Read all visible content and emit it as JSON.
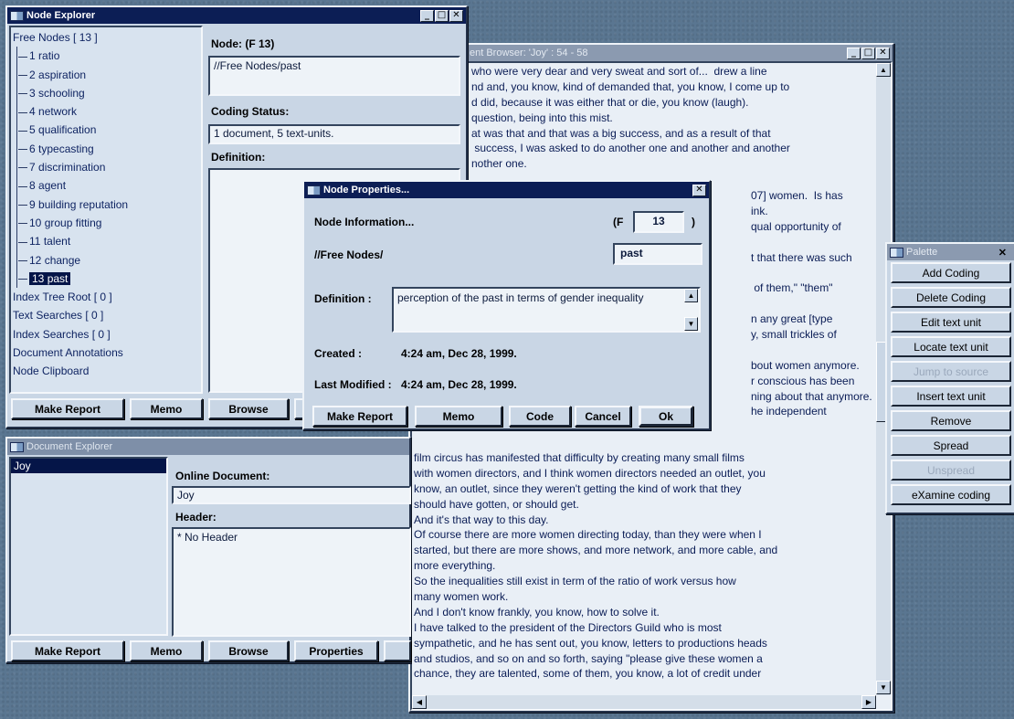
{
  "node_explorer": {
    "title": "Node Explorer",
    "free_nodes_label": "Free Nodes [ 13 ]",
    "nodes": [
      {
        "num": "1",
        "label": "ratio"
      },
      {
        "num": "2",
        "label": "aspiration"
      },
      {
        "num": "3",
        "label": "schooling"
      },
      {
        "num": "4",
        "label": "network"
      },
      {
        "num": "5",
        "label": "qualification"
      },
      {
        "num": "6",
        "label": "typecasting"
      },
      {
        "num": "7",
        "label": "discrimination"
      },
      {
        "num": "8",
        "label": "agent"
      },
      {
        "num": "9",
        "label": "building reputation"
      },
      {
        "num": "10",
        "label": "group fitting"
      },
      {
        "num": "11",
        "label": "talent"
      },
      {
        "num": "12",
        "label": "change"
      },
      {
        "num": "13",
        "label": "past"
      }
    ],
    "roots": [
      "Index Tree Root [ 0 ]",
      "Text Searches [ 0 ]",
      "Index Searches [ 0 ]",
      "Document Annotations",
      "Node Clipboard"
    ],
    "node_label": "Node: (F 13)",
    "node_path": "//Free Nodes/past",
    "coding_status_label": "Coding Status:",
    "coding_status_value": "1 document, 5 text-units.",
    "definition_label": "Definition:",
    "buttons": {
      "make_report": "Make Report",
      "memo": "Memo",
      "browse": "Browse"
    }
  },
  "document_browser": {
    "title": "ent Browser: 'Joy' : 54 - 58",
    "lines_top": [
      "who were very dear and very sweat and sort of...  drew a line",
      "nd and, you know, kind of demanded that, you know, I come up to",
      "d did, because it was either that or die, you know (laugh).",
      "question, being into this mist.",
      "at was that and that was a big success, and as a result of that",
      " success, I was asked to do another one and another and another",
      "nother one."
    ],
    "lines_right": [
      "07] women.  Is has",
      "ink.",
      "qual opportunity of",
      "",
      "t that there was such",
      "",
      " of them,\" \"them\"",
      "",
      "n any great [type",
      "y, small trickles of",
      "",
      "bout women anymore.",
      "r conscious has been",
      "ning about that anymore.",
      "he independent"
    ],
    "lines_bottom": [
      "film circus has manifested that difficulty by creating many small films",
      "with women directors, and I think women directors needed an outlet, you",
      "know, an outlet, since they weren't getting the kind of work that they",
      "should have gotten, or should get.",
      "And it's that way to this day.",
      "Of course there are more women directing today, than they were when I",
      "started, but there are more shows, and more network, and more cable, and",
      "more everything.",
      "So the inequalities still exist in term of the ratio of work versus how",
      "many women work.",
      "And I don't know frankly, you know, how to solve it.",
      "I have talked to the president of the Directors Guild who is most",
      "sympathetic, and he has sent out, you know, letters to productions heads",
      "and studios, and so on and so forth, saying \"please give these women a",
      "chance, they are talented, some of them, you know, a lot of credit under"
    ]
  },
  "node_properties": {
    "title": "Node Properties...",
    "node_information_label": "Node Information...",
    "f_prefix": "(F",
    "f_number": "13",
    "f_suffix": ")",
    "path_label": "//Free Nodes/",
    "name_value": "past",
    "definition_label": "Definition :",
    "definition_value": "perception of the past in terms of gender inequality",
    "created_label": "Created :",
    "created_value": "4:24 am, Dec 28, 1999.",
    "modified_label": "Last Modified :",
    "modified_value": "4:24 am, Dec 28, 1999.",
    "buttons": {
      "make_report": "Make Report",
      "memo": "Memo",
      "code": "Code",
      "cancel": "Cancel",
      "ok": "Ok"
    }
  },
  "document_explorer": {
    "title": "Document Explorer",
    "documents": [
      "Joy"
    ],
    "online_label": "Online Document:",
    "online_value": "Joy",
    "header_label": "Header:",
    "header_value": "* No Header",
    "buttons": {
      "make_report": "Make Report",
      "memo": "Memo",
      "browse": "Browse",
      "properties": "Properties"
    }
  },
  "palette": {
    "title": "Palette",
    "items": [
      {
        "label": "Add Coding",
        "enabled": true
      },
      {
        "label": "Delete Coding",
        "enabled": true
      },
      {
        "label": "Edit text unit",
        "enabled": true
      },
      {
        "label": "Locate text unit",
        "enabled": true
      },
      {
        "label": "Jump to source",
        "enabled": false
      },
      {
        "label": "Insert text unit",
        "enabled": true
      },
      {
        "label": "Remove",
        "enabled": true
      },
      {
        "label": "Spread",
        "enabled": true
      },
      {
        "label": "Unspread",
        "enabled": false
      },
      {
        "label": "eXamine coding",
        "enabled": true
      }
    ]
  }
}
